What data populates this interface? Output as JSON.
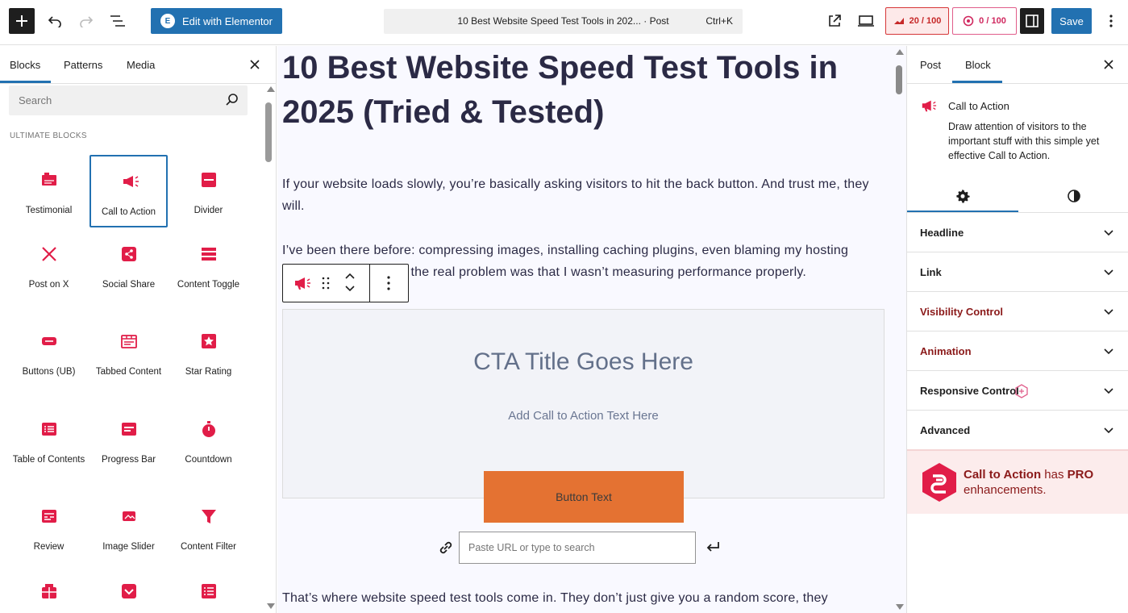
{
  "topbar": {
    "elementor_label": "Edit with Elementor",
    "doc_title": "10 Best Website Speed Test Tools in 202... · Post",
    "shortcut": "Ctrl+K",
    "score1": "20 / 100",
    "score2": "0 / 100",
    "save_label": "Save"
  },
  "left_panel": {
    "tabs": [
      "Blocks",
      "Patterns",
      "Media"
    ],
    "search_placeholder": "Search",
    "category": "ULTIMATE BLOCKS",
    "blocks": [
      {
        "label": "Testimonial",
        "icon": "testimonial-icon"
      },
      {
        "label": "Call to Action",
        "icon": "megaphone-icon"
      },
      {
        "label": "Divider",
        "icon": "divider-icon"
      },
      {
        "label": "Post on X",
        "icon": "x-logo-icon"
      },
      {
        "label": "Social Share",
        "icon": "share-icon"
      },
      {
        "label": "Content Toggle",
        "icon": "toggle-icon"
      },
      {
        "label": "Buttons (UB)",
        "icon": "button-icon"
      },
      {
        "label": "Tabbed Content",
        "icon": "tabs-icon"
      },
      {
        "label": "Star Rating",
        "icon": "star-icon"
      },
      {
        "label": "Table of Contents",
        "icon": "toc-icon"
      },
      {
        "label": "Progress Bar",
        "icon": "progress-icon"
      },
      {
        "label": "Countdown",
        "icon": "stopwatch-icon"
      },
      {
        "label": "Review",
        "icon": "review-icon"
      },
      {
        "label": "Image Slider",
        "icon": "slider-icon"
      },
      {
        "label": "Content Filter",
        "icon": "filter-icon"
      },
      {
        "label": "",
        "icon": "gift-icon"
      },
      {
        "label": "",
        "icon": "dropdown-icon"
      },
      {
        "label": "",
        "icon": "list-icon"
      }
    ]
  },
  "canvas": {
    "post_title": "10 Best Website Speed Test Tools in 2025 (Tried & Tested)",
    "p1": "If your website loads slowly, you’re basically asking visitors to hit the back button. And trust me, they will.",
    "p2": "I’ve been there before: compressing images, installing caching plugins, even blaming my hosting provider. But I realize the real problem was that I wasn’t measuring performance properly.",
    "cta_title": "CTA Title Goes Here",
    "cta_text": "Add Call to Action Text Here",
    "cta_button": "Button Text",
    "url_placeholder": "Paste URL or type to search",
    "p3": "That’s where website speed test tools come in. They don’t just give you a random score, they"
  },
  "right_panel": {
    "tabs": [
      "Post",
      "Block"
    ],
    "block_title": "Call to Action",
    "block_desc": "Draw attention of visitors to the important stuff with this simple yet effective Call to Action.",
    "accordions": [
      "Headline",
      "Link",
      "Visibility Control",
      "Animation",
      "Responsive Control",
      "Advanced"
    ],
    "pro_name": "Call to Action",
    "pro_has": " has ",
    "pro_badge": "PRO",
    "pro_tail": "enhancements."
  },
  "colors": {
    "accent": "#2271b1",
    "brand_red": "#e11d48",
    "cta_button": "#e47232"
  }
}
